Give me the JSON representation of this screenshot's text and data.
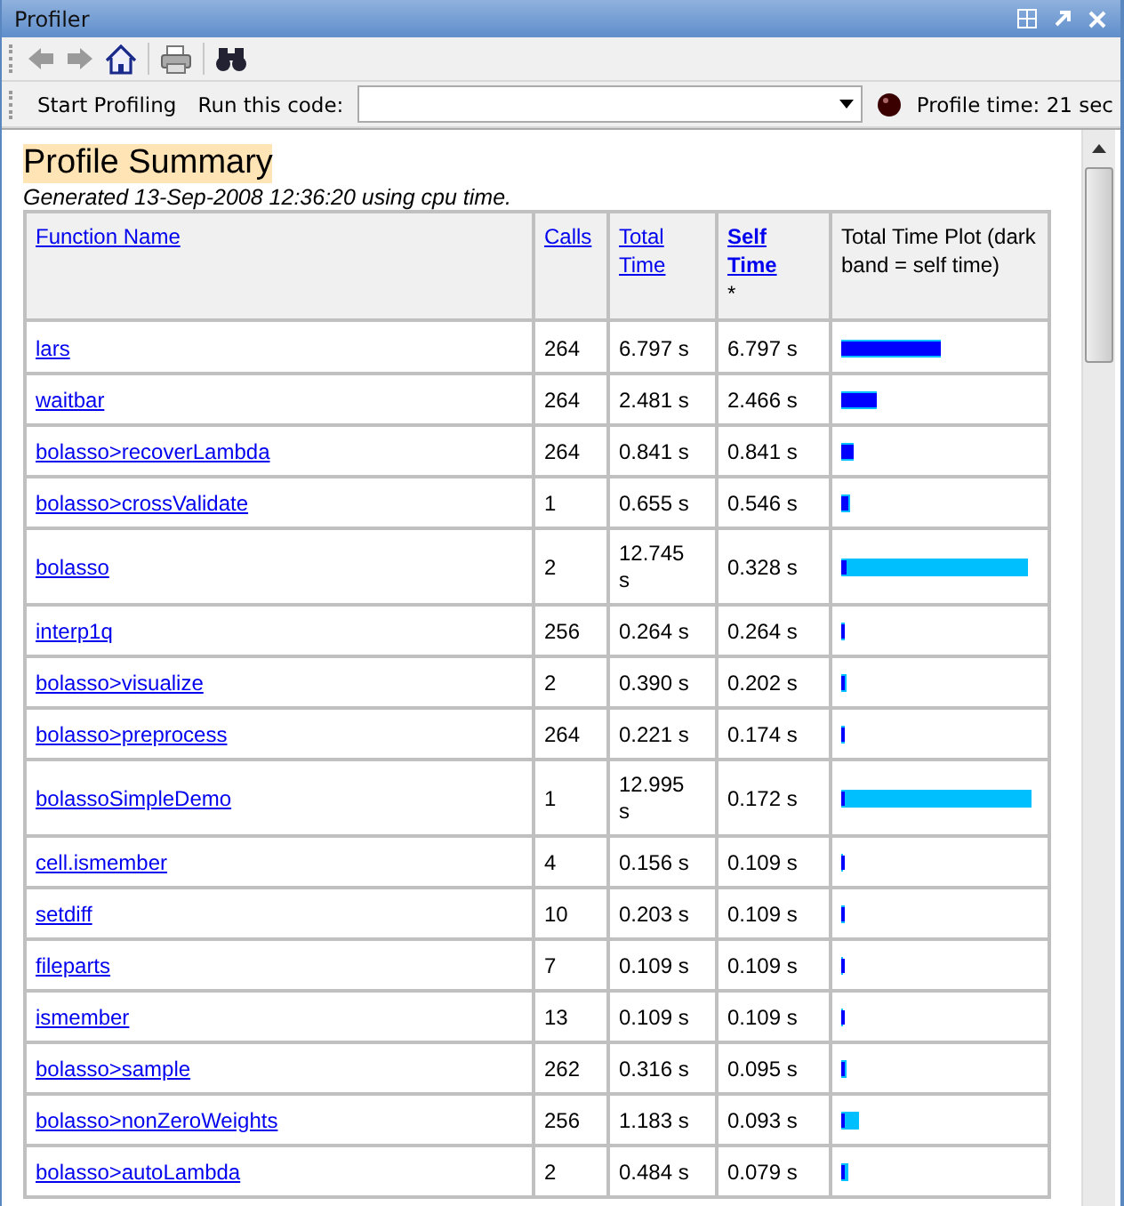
{
  "window": {
    "title": "Profiler"
  },
  "toolbar": {
    "start_button": "Start Profiling",
    "run_label": "Run this code:",
    "profile_time": "Profile time: 21 sec"
  },
  "summary": {
    "title": "Profile Summary",
    "generated": "Generated 13-Sep-2008 12:36:20 using cpu time."
  },
  "table": {
    "columns": [
      {
        "label": "Function Name",
        "link": true,
        "bold": false
      },
      {
        "label": "Calls",
        "link": true,
        "bold": false
      },
      {
        "label": "Total Time",
        "link": true,
        "bold": false
      },
      {
        "label": "Self Time",
        "link": true,
        "bold": true,
        "suffix": "*"
      },
      {
        "label": "Total Time Plot (dark band = self time)",
        "link": false,
        "bold": false
      }
    ],
    "rows": [
      {
        "name": "lars",
        "calls": "264",
        "total": "6.797 s",
        "self": "6.797 s",
        "total_bar": {
          "level": 0.503
        },
        "self_bar": {
          "level": 0.503
        }
      },
      {
        "name": "waitbar",
        "calls": "264",
        "total": "2.481 s",
        "self": "2.466 s",
        "total_bar": {
          "level": 0.184
        },
        "self_bar": {
          "level": 0.183
        }
      },
      {
        "name": "bolasso>recoverLambda",
        "calls": "264",
        "total": "0.841 s",
        "self": "0.841 s",
        "total_bar": {
          "level": 0.062
        },
        "self_bar": {
          "level": 0.062
        }
      },
      {
        "name": "bolasso>crossValidate",
        "calls": "1",
        "total": "0.655 s",
        "self": "0.546 s",
        "total_bar": {
          "level": 0.049
        },
        "self_bar": {
          "level": 0.04
        }
      },
      {
        "name": "bolasso",
        "calls": "2",
        "total": "12.745 s",
        "self": "0.328 s",
        "total_bar": {
          "level": 0.944
        },
        "self_bar": {
          "level": 0.024
        }
      },
      {
        "name": "interp1q",
        "calls": "256",
        "total": "0.264 s",
        "self": "0.264 s",
        "total_bar": {
          "level": 0.02
        },
        "self_bar": {
          "level": 0.02
        }
      },
      {
        "name": "bolasso>visualize",
        "calls": "2",
        "total": "0.390 s",
        "self": "0.202 s",
        "total_bar": {
          "level": 0.029
        },
        "self_bar": {
          "level": 0.015
        }
      },
      {
        "name": "bolasso>preprocess",
        "calls": "264",
        "total": "0.221 s",
        "self": "0.174 s",
        "total_bar": {
          "level": 0.016
        },
        "self_bar": {
          "level": 0.013
        }
      },
      {
        "name": "bolassoSimpleDemo",
        "calls": "1",
        "total": "12.995 s",
        "self": "0.172 s",
        "total_bar": {
          "level": 0.963
        },
        "self_bar": {
          "level": 0.013
        }
      },
      {
        "name": "cell.ismember",
        "calls": "4",
        "total": "0.156 s",
        "self": "0.109 s",
        "total_bar": {
          "level": 0.012
        },
        "self_bar": {
          "level": 0.008
        }
      },
      {
        "name": "setdiff",
        "calls": "10",
        "total": "0.203 s",
        "self": "0.109 s",
        "total_bar": {
          "level": 0.015
        },
        "self_bar": {
          "level": 0.008
        }
      },
      {
        "name": "fileparts",
        "calls": "7",
        "total": "0.109 s",
        "self": "0.109 s",
        "total_bar": {
          "level": 0.008
        },
        "self_bar": {
          "level": 0.008
        }
      },
      {
        "name": "ismember",
        "calls": "13",
        "total": "0.109 s",
        "self": "0.109 s",
        "total_bar": {
          "level": 0.008
        },
        "self_bar": {
          "level": 0.008
        }
      },
      {
        "name": "bolasso>sample",
        "calls": "262",
        "total": "0.316 s",
        "self": "0.095 s",
        "total_bar": {
          "level": 0.023
        },
        "self_bar": {
          "level": 0.007
        }
      },
      {
        "name": "bolasso>nonZeroWeights",
        "calls": "256",
        "total": "1.183 s",
        "self": "0.093 s",
        "total_bar": {
          "level": 0.088
        },
        "self_bar": {
          "level": 0.007
        }
      },
      {
        "name": "bolasso>autoLambda",
        "calls": "2",
        "total": "0.484 s",
        "self": "0.079 s",
        "total_bar": {
          "level": 0.036
        },
        "self_bar": {
          "level": 0.006
        }
      }
    ]
  }
}
